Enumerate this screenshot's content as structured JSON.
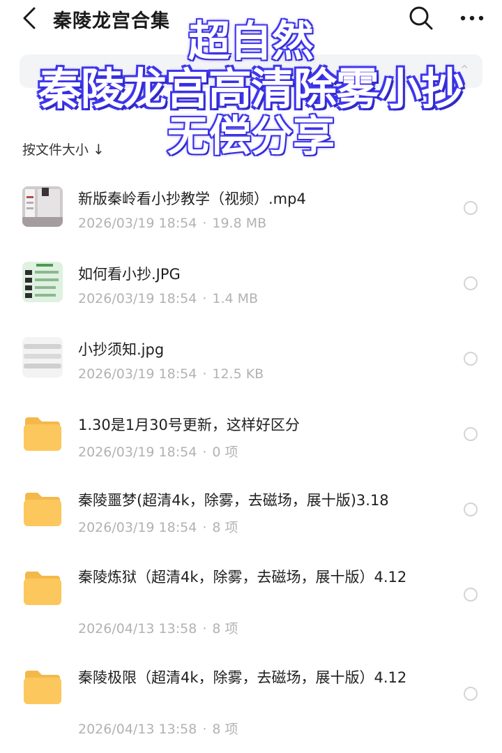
{
  "header": {
    "title": "秦陵龙宫合集",
    "back_icon": "chevron-left-icon",
    "search_icon": "search-icon",
    "more_icon": "more-dots-icon"
  },
  "search_bar": {
    "hint": "^"
  },
  "sort": {
    "label": "按文件大小",
    "arrow": "↓"
  },
  "files": [
    {
      "name": "新版秦岭看小抄教学（视频）.mp4",
      "date": "2026/03/19 18:54",
      "size": "19.8 MB",
      "kind": "video"
    },
    {
      "name": "如何看小抄.JPG",
      "date": "2026/03/19 18:54",
      "size": "1.4 MB",
      "kind": "image"
    },
    {
      "name": "小抄须知.jpg",
      "date": "2026/03/19 18:54",
      "size": "12.5 KB",
      "kind": "image"
    },
    {
      "name": "1.30是1月30号更新，这样好区分",
      "date": "2026/03/19 18:54",
      "size": "0 项",
      "kind": "folder"
    },
    {
      "name": "秦陵噩梦(超清4k，除雾，去磁场，展十版)3.18",
      "date": "2026/03/19 18:54",
      "size": "8 项",
      "kind": "folder"
    },
    {
      "name": "秦陵炼狱（超清4k，除雾，去磁场，展十版）4.12",
      "date": "2026/04/13 13:58",
      "size": "8 项",
      "kind": "folder"
    },
    {
      "name": "秦陵极限（超清4k，除雾，去磁场，展十版）4.12",
      "date": "2026/04/13 13:58",
      "size": "8 项",
      "kind": "folder"
    }
  ],
  "meta_separator": "·",
  "overlay": {
    "line1": "超自然",
    "line2": "秦陵龙宫高清除雾小抄",
    "line3": "无偿分享",
    "fill_color": "#ffffff",
    "stroke_color": "#3f3af0"
  },
  "colors": {
    "folder": "#fbc55a",
    "meta_text": "#b2b2b2",
    "search_bg": "#f3f4f6"
  }
}
